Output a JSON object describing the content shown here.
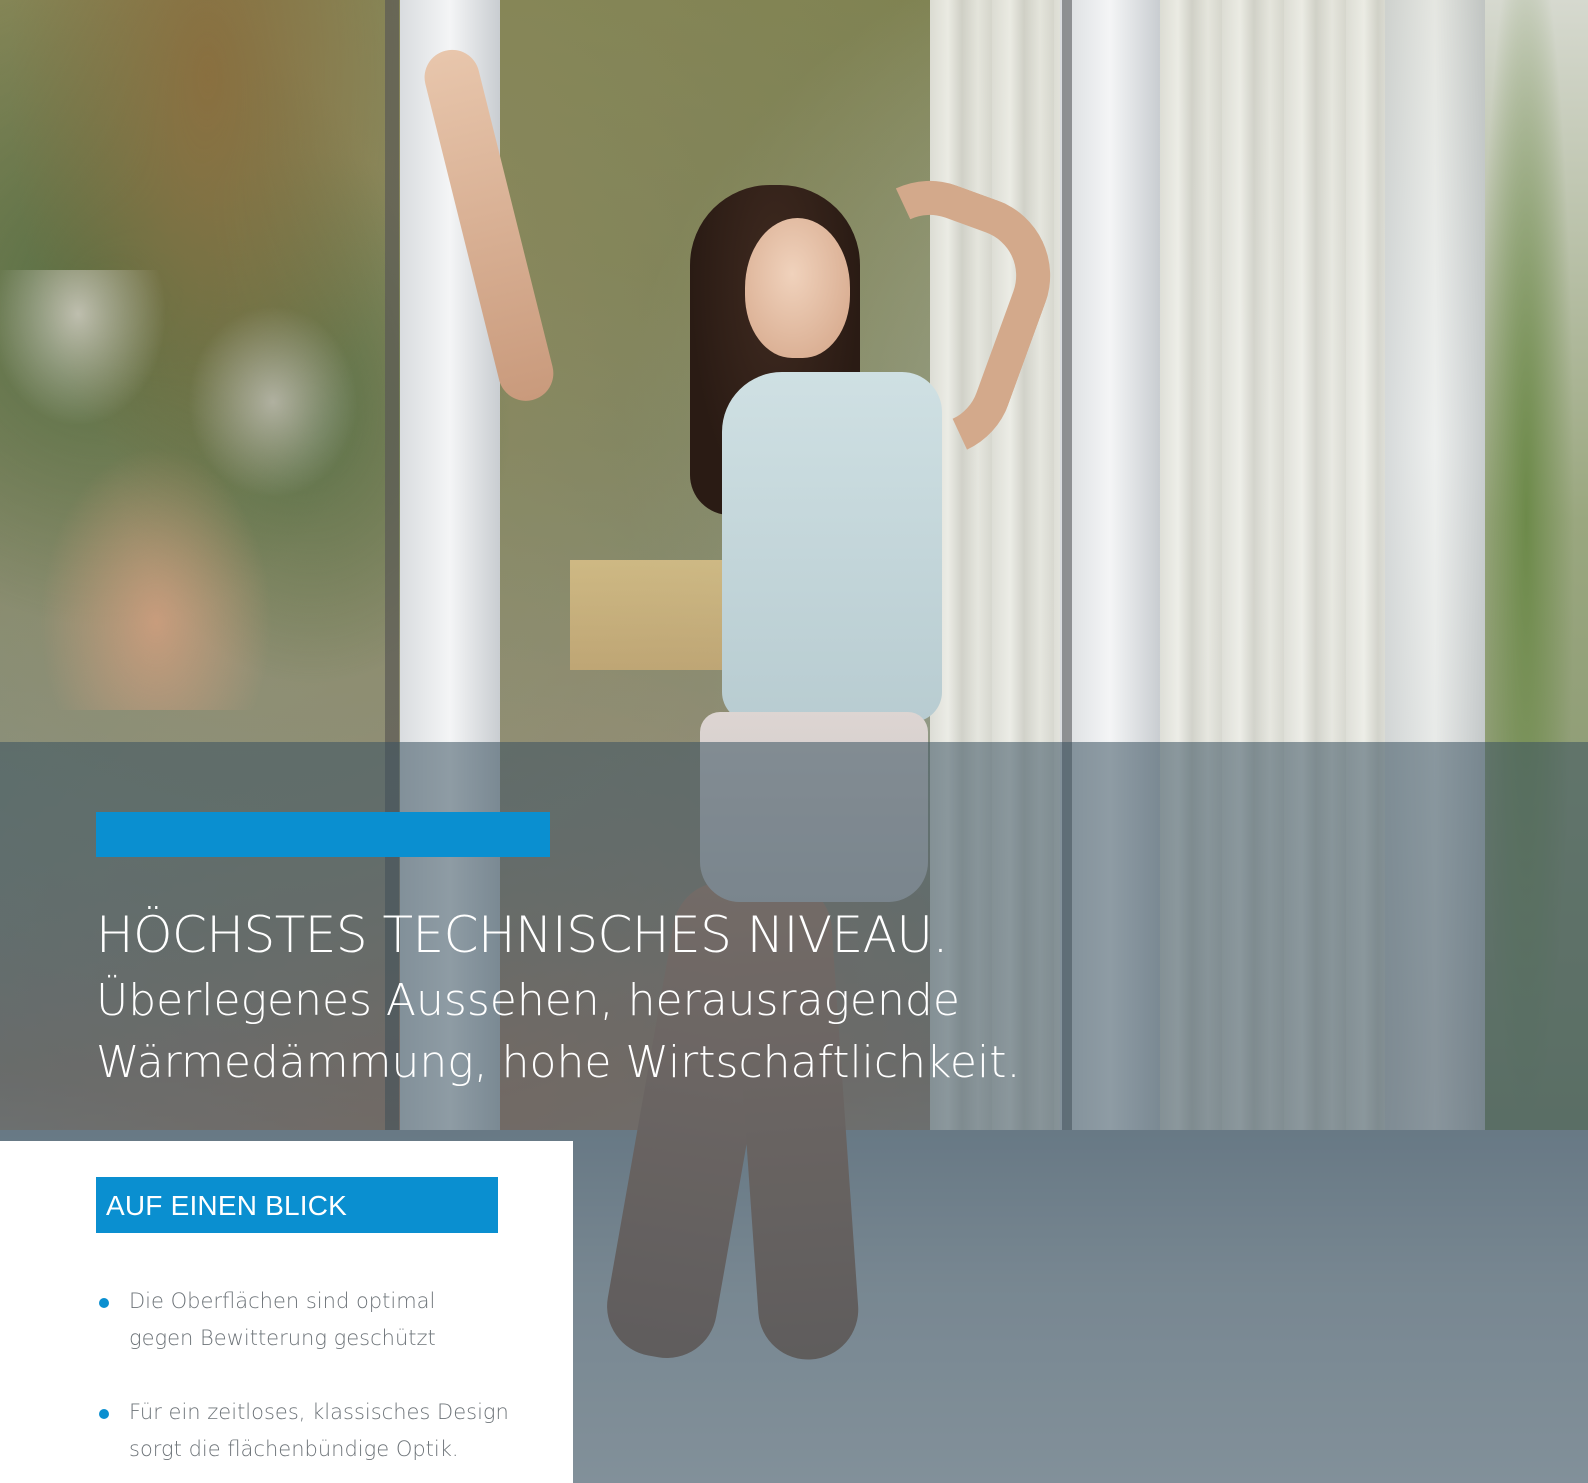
{
  "hero": {
    "headline": "HÖCHSTES TECHNISCHES NIVEAU.",
    "subline_1": "Überlegenes Aussehen, herausragende",
    "subline_2": "Wärmedämmung, hohe Wirtschaftlichkeit."
  },
  "at_a_glance": {
    "title": "AUF EINEN BLICK",
    "items": [
      {
        "line_1": "Die Oberflächen sind optimal",
        "line_2": "gegen Bewitterung geschützt"
      },
      {
        "line_1": "Für ein zeitloses, klassisches Design",
        "line_2": "sorgt die flächenbündige Optik."
      }
    ]
  },
  "colors": {
    "accent": "#0a8fd0",
    "overlay": "rgba(58, 82, 96, 0.55)",
    "body_text": "#6e7479",
    "headline_text": "#ffffff"
  },
  "icons": [
    "bullet-dot-icon",
    "bullet-dot-icon"
  ]
}
